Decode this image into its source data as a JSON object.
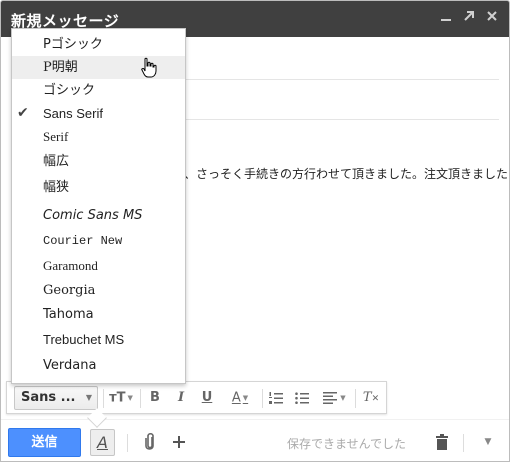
{
  "window": {
    "title": "新規メッセージ",
    "controls": {
      "minimize": "_",
      "popout": "↗",
      "close": "✕"
    }
  },
  "body": {
    "text_visible": "、さっそく手続きの方行わせて頂きました。注文頂きました"
  },
  "font_menu": {
    "items": [
      {
        "label": "Pゴシック",
        "selected": false,
        "hover": false
      },
      {
        "label": "P明朝",
        "selected": false,
        "hover": true
      },
      {
        "label": "ゴシック",
        "selected": false,
        "hover": false
      },
      {
        "label": "Sans Serif",
        "selected": true,
        "hover": false
      },
      {
        "label": "Serif",
        "selected": false,
        "hover": false
      },
      {
        "label": "幅広",
        "selected": false,
        "hover": false
      },
      {
        "label": "幅狭",
        "selected": false,
        "hover": false
      },
      {
        "label": "Comic Sans MS",
        "selected": false,
        "hover": false
      },
      {
        "label": "Courier New",
        "selected": false,
        "hover": false
      },
      {
        "label": "Garamond",
        "selected": false,
        "hover": false
      },
      {
        "label": "Georgia",
        "selected": false,
        "hover": false
      },
      {
        "label": "Tahoma",
        "selected": false,
        "hover": false
      },
      {
        "label": "Trebuchet MS",
        "selected": false,
        "hover": false
      },
      {
        "label": "Verdana",
        "selected": false,
        "hover": false
      }
    ],
    "check_glyph": "✔"
  },
  "format_toolbar": {
    "font_button_label": "Sans ...",
    "size_glyph": "ᴛT",
    "bold": "B",
    "italic": "I",
    "underline": "U",
    "text_color": "A",
    "numbered_list": "☰",
    "bulleted_list": "☰",
    "align": "☰",
    "remove_formatting": "T"
  },
  "bottom_bar": {
    "send_label": "送信",
    "format_toggle": "A",
    "attach_icon": "paperclip-icon",
    "insert_icon": "plus-icon",
    "save_status": "保存できませんでした",
    "delete_icon": "trash-icon",
    "more_icon": "chevron-down-icon"
  },
  "colors": {
    "titlebar": "#404040",
    "send_button": "#4d90fe",
    "menu_hover": "#eeeeee"
  }
}
